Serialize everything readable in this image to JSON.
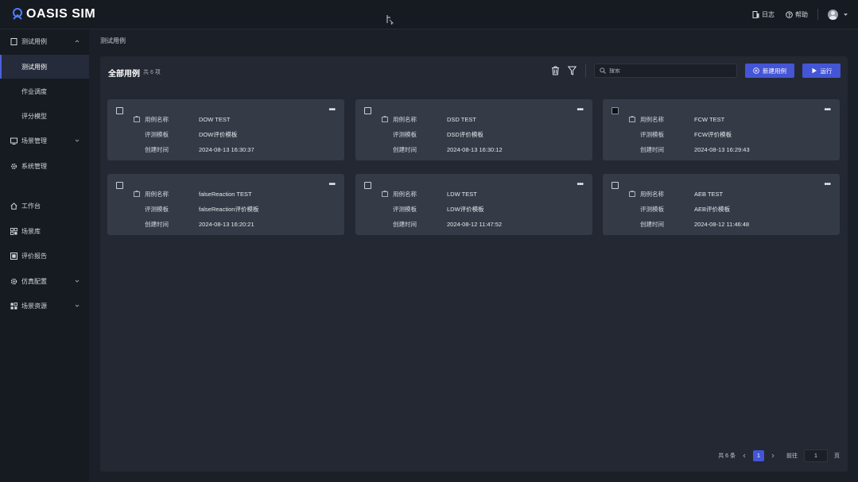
{
  "header": {
    "logo_text": "OASIS SIM",
    "links": [
      {
        "icon": "document-icon",
        "label": "日志"
      },
      {
        "icon": "help-icon",
        "label": "帮助"
      }
    ]
  },
  "sidebar": {
    "groups": [
      {
        "icon": "file-icon",
        "label": "测试用例",
        "expanded": true,
        "items": [
          {
            "label": "测试用例",
            "active": true
          },
          {
            "label": "作业调度"
          },
          {
            "label": "评分模型"
          }
        ]
      },
      {
        "icon": "monitor-icon",
        "label": "场景管理",
        "expanded": false
      },
      {
        "icon": "gear-icon",
        "label": "系统管理"
      }
    ],
    "bottom_items": [
      {
        "icon": "home-icon",
        "label": "工作台"
      },
      {
        "icon": "grid-icon",
        "label": "场景库"
      },
      {
        "icon": "report-icon",
        "label": "评价报告"
      },
      {
        "icon": "settings-icon",
        "label": "仿真配置",
        "has_children": true
      },
      {
        "icon": "apps-icon",
        "label": "场景资源",
        "has_children": true
      }
    ]
  },
  "breadcrumb": "测试用例",
  "panel": {
    "title": "全部用例",
    "count_text": "共 6 项",
    "search_placeholder": "搜索",
    "new_button": "新建用例",
    "run_button": "运行"
  },
  "field_labels": {
    "name": "用例名称",
    "template": "评测模板",
    "created": "创建时间"
  },
  "cards": [
    {
      "name": "DOW TEST",
      "template": "DOW评价模板",
      "created": "2024-08-13 16:30:37",
      "checked": false
    },
    {
      "name": "DSD TEST",
      "template": "DSD评价模板",
      "created": "2024-08-13 16:30:12",
      "checked": false
    },
    {
      "name": "FCW TEST",
      "template": "FCW评价模板",
      "created": "2024-08-13 16:29:43",
      "checked": true
    },
    {
      "name": "falseReaction TEST",
      "template": "falseReaction评价模板",
      "created": "2024-08-13 16:20:21",
      "checked": false
    },
    {
      "name": "LDW TEST",
      "template": "LDW评价模板",
      "created": "2024-08-12 11:47:52",
      "checked": false
    },
    {
      "name": "AEB TEST",
      "template": "AEB评价模板",
      "created": "2024-08-12 11:46:48",
      "checked": false
    }
  ],
  "pagination": {
    "total_text": "共 6 条",
    "current_page": "1",
    "goto_label": "前往",
    "goto_value": "1",
    "page_suffix": "页"
  },
  "colors": {
    "accent": "#4455d6",
    "background": "#1b1f27",
    "card": "#343a46"
  }
}
